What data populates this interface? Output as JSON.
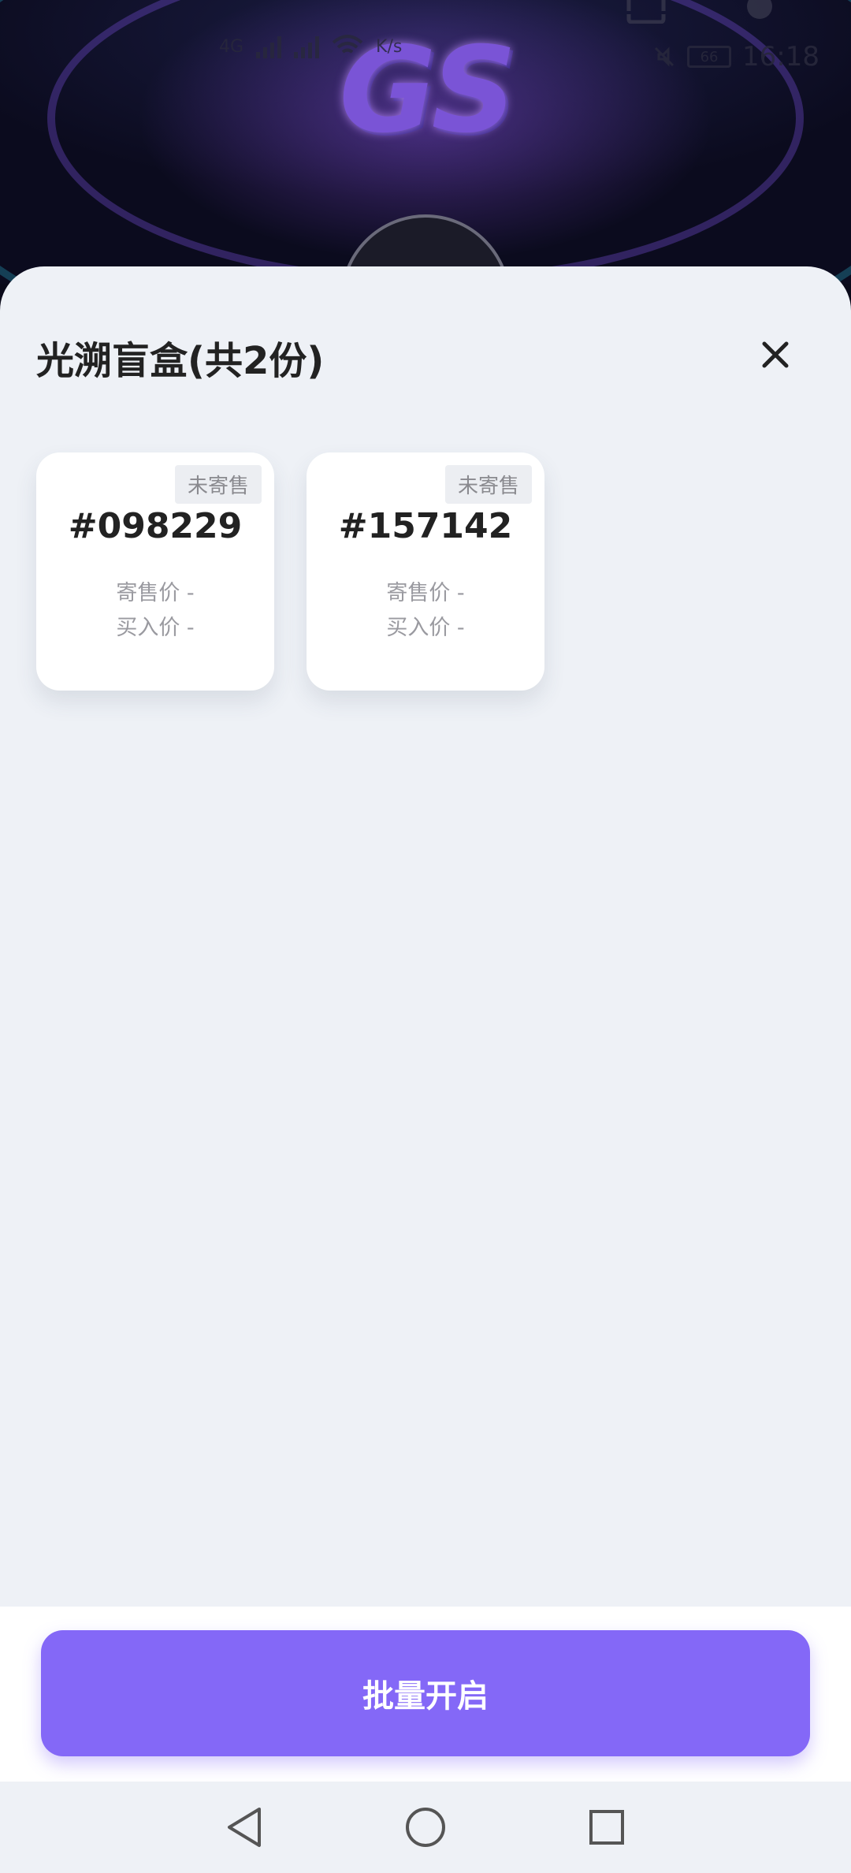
{
  "status_bar": {
    "network_left": "4G",
    "speed": "K/s",
    "time": "16:18",
    "battery": "66"
  },
  "background": {
    "logo_text": "GS"
  },
  "sheet": {
    "title": "光溯盲盒(共2份)",
    "close_icon": "close-icon"
  },
  "cards": [
    {
      "badge": "未寄售",
      "number": "#098229",
      "sale_price": "寄售价 -",
      "buy_price": "买入价 -"
    },
    {
      "badge": "未寄售",
      "number": "#157142",
      "sale_price": "寄售价 -",
      "buy_price": "买入价 -"
    }
  ],
  "action": {
    "batch_open_label": "批量开启"
  },
  "nav": {
    "back_icon": "back-triangle-icon",
    "home_icon": "home-circle-icon",
    "recents_icon": "recents-square-icon"
  },
  "colors": {
    "accent": "#8468f7",
    "sheet_bg": "#eef1f6",
    "card_bg": "#ffffff",
    "badge_bg": "#eceef2",
    "badge_text": "#8a8a8f"
  }
}
